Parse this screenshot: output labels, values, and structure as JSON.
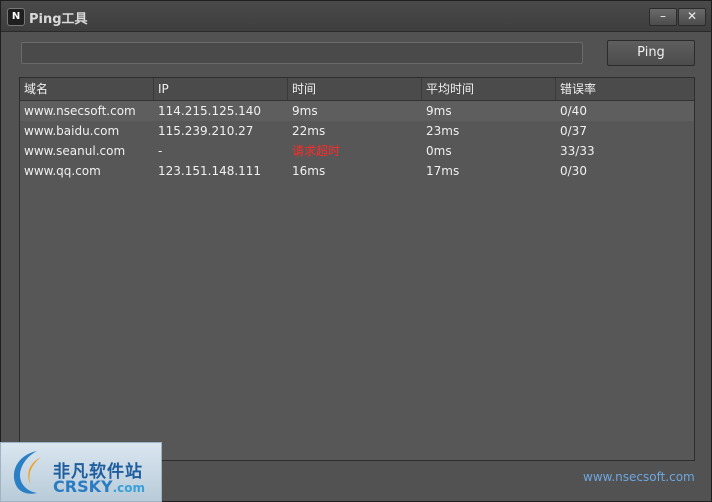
{
  "window": {
    "title": "Ping工具",
    "app_icon_text": "N",
    "minimize_label": "–",
    "close_label": "✕"
  },
  "toolbar": {
    "host_input_value": "",
    "ping_button_label": "Ping"
  },
  "table": {
    "columns": [
      "域名",
      "IP",
      "时间",
      "平均时间",
      "错误率"
    ],
    "rows": [
      {
        "domain": "www.nsecsoft.com",
        "ip": "114.215.125.140",
        "time": "9ms",
        "avg": "9ms",
        "error_rate": "0/40"
      },
      {
        "domain": "www.baidu.com",
        "ip": "115.239.210.27",
        "time": "22ms",
        "avg": "23ms",
        "error_rate": "0/37"
      },
      {
        "domain": "www.seanul.com",
        "ip": "-",
        "time": "请求超时",
        "avg": "0ms",
        "error_rate": "33/33"
      },
      {
        "domain": "www.qq.com",
        "ip": "123.151.148.111",
        "time": "16ms",
        "avg": "17ms",
        "error_rate": "0/30"
      }
    ]
  },
  "footer": {
    "site_link": "www.nsecsoft.com"
  },
  "watermark": {
    "cn_text": "非凡软件站",
    "en_text": "CRSKY",
    "en_suffix": ".com"
  },
  "colors": {
    "error_text": "#ff2a2a",
    "link": "#6ea6e0"
  }
}
